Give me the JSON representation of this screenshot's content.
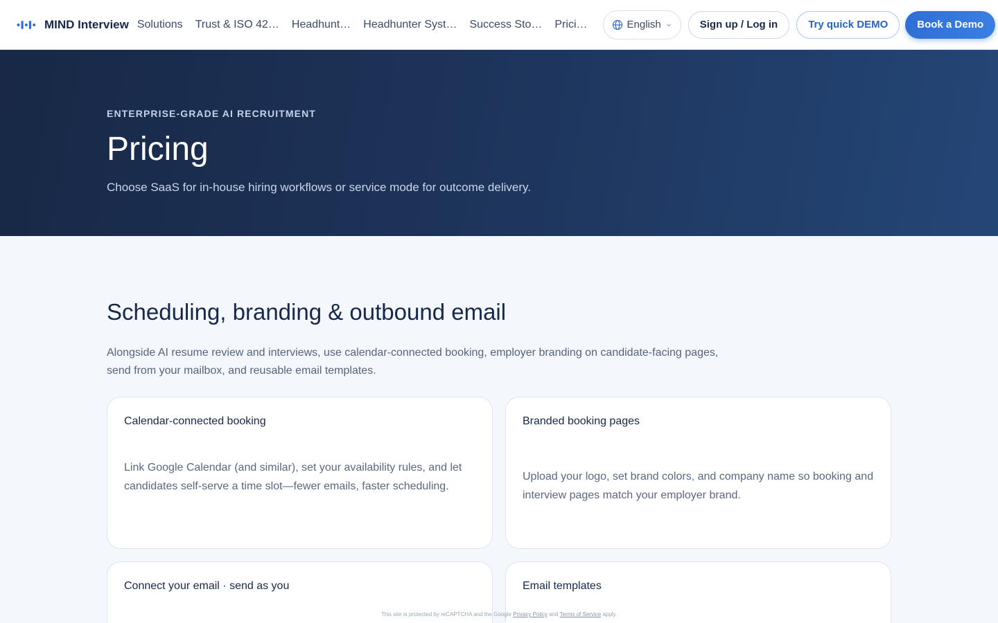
{
  "header": {
    "brand": "MIND Interview",
    "nav": [
      "Solutions",
      "Trust & ISO 42…",
      "Headhunt…",
      "Headhunter Syst…",
      "Success Sto…",
      "Prici…"
    ],
    "language": "English",
    "signup_label": "Sign up / Log in",
    "demo_label": "Try quick DEMO",
    "book_label": "Book a Demo"
  },
  "hero": {
    "eyebrow": "ENTERPRISE-GRADE AI RECRUITMENT",
    "title": "Pricing",
    "subtitle": "Choose SaaS for in-house hiring workflows or service mode for outcome delivery."
  },
  "section": {
    "title": "Scheduling, branding & outbound email",
    "description": "Alongside AI resume review and interviews, use calendar-connected booking, employer branding on candidate-facing pages, send from your mailbox, and reusable email templates."
  },
  "cards": [
    {
      "title": "Calendar-connected booking",
      "body": "Link Google Calendar (and similar), set your availability rules, and let candidates self-serve a time slot—fewer emails, faster scheduling."
    },
    {
      "title": "Branded booking pages",
      "body": "Upload your logo, set brand colors, and company name so booking and interview pages match your employer brand."
    },
    {
      "title": "Connect your email · send as you",
      "body": ""
    },
    {
      "title": "Email templates",
      "body": ""
    }
  ],
  "recaptcha": {
    "prefix": "This site is protected by reCAPTCHA and the Google",
    "privacy": "Privacy Policy",
    "and": "and",
    "terms": "Terms of Service",
    "suffix": "apply."
  },
  "colors": {
    "primary": "#2f6fd6",
    "hero_dark": "#182846",
    "hero_light": "#244677",
    "page_bg": "#f4f7fc"
  }
}
